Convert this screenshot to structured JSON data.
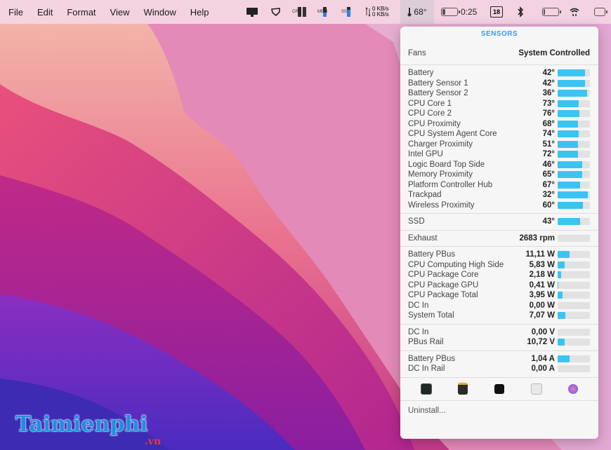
{
  "menubar": {
    "menus": [
      "File",
      "Edit",
      "Format",
      "View",
      "Window",
      "Help"
    ],
    "tray": {
      "network_up": "0 KB/s",
      "network_down": "0 KB/s",
      "temperature": "68°",
      "battery_time": "0:25",
      "calendar_day": "18",
      "cpu_label": "CPU",
      "mem_label": "MEM",
      "ssd_label": "SSD"
    }
  },
  "panel": {
    "title": "SENSORS",
    "fans": {
      "label": "Fans",
      "value": "System Controlled"
    },
    "temperatures": [
      {
        "label": "Battery",
        "value": "42°",
        "level": 0.84
      },
      {
        "label": "Battery Sensor 1",
        "value": "42°",
        "level": 0.84
      },
      {
        "label": "Battery Sensor 2",
        "value": "36°",
        "level": 0.92
      },
      {
        "label": "CPU Core 1",
        "value": "73°",
        "level": 0.66
      },
      {
        "label": "CPU Core 2",
        "value": "76°",
        "level": 0.68
      },
      {
        "label": "CPU Proximity",
        "value": "68°",
        "level": 0.63
      },
      {
        "label": "CPU System Agent Core",
        "value": "74°",
        "level": 0.66
      },
      {
        "label": "Charger Proximity",
        "value": "51°",
        "level": 0.63
      },
      {
        "label": "Intel GPU",
        "value": "72°",
        "level": 0.63
      },
      {
        "label": "Logic Board Top Side",
        "value": "46°",
        "level": 0.76
      },
      {
        "label": "Memory Proximity",
        "value": "65°",
        "level": 0.76
      },
      {
        "label": "Platform Controller Hub",
        "value": "67°",
        "level": 0.7
      },
      {
        "label": "Trackpad",
        "value": "32°",
        "level": 0.94
      },
      {
        "label": "Wireless Proximity",
        "value": "60°",
        "level": 0.78
      }
    ],
    "ssd": [
      {
        "label": "SSD",
        "value": "43°",
        "level": 0.7
      }
    ],
    "exhaust": [
      {
        "label": "Exhaust",
        "value": "2683 rpm",
        "level": 0
      }
    ],
    "power": [
      {
        "label": "Battery PBus",
        "value": "11,11 W",
        "level": 0.38
      },
      {
        "label": "CPU Computing High Side",
        "value": "5,83 W",
        "level": 0.22
      },
      {
        "label": "CPU Package Core",
        "value": "2,18 W",
        "level": 0.1
      },
      {
        "label": "CPU Package GPU",
        "value": "0,41 W",
        "level": 0.03
      },
      {
        "label": "CPU Package Total",
        "value": "3,95 W",
        "level": 0.16
      },
      {
        "label": "DC In",
        "value": "0,00 W",
        "level": 0
      },
      {
        "label": "System Total",
        "value": "7,07 W",
        "level": 0.24
      }
    ],
    "voltage": [
      {
        "label": "DC In",
        "value": "0,00 V",
        "level": 0
      },
      {
        "label": "PBus Rail",
        "value": "10,72 V",
        "level": 0.22
      }
    ],
    "current": [
      {
        "label": "Battery PBus",
        "value": "1,04 A",
        "level": 0.36
      },
      {
        "label": "DC In Rail",
        "value": "0,00 A",
        "level": 0
      }
    ],
    "dock_icons": [
      "activity-monitor-icon",
      "console-icon",
      "terminal-icon",
      "disk-utility-icon",
      "system-preferences-icon"
    ],
    "uninstall_label": "Uninstall..."
  },
  "watermark": {
    "brand": "aimienphi",
    "brand_initial": "T",
    "suffix": ".vn"
  },
  "colors": {
    "bar": "#3bc4f2",
    "bar_track": "#e2e2e2",
    "title": "#3b9be8"
  }
}
